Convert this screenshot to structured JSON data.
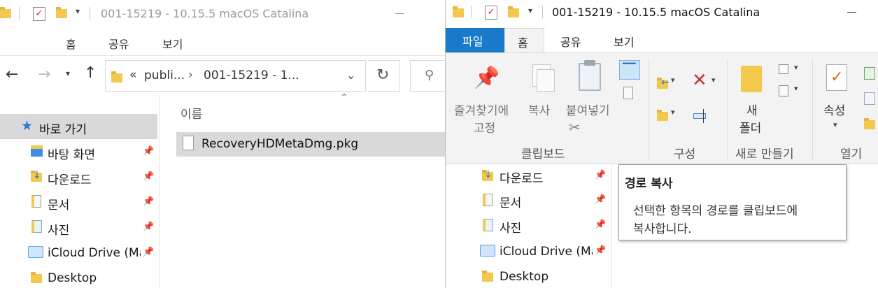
{
  "left": {
    "title": "001-15219 - 10.15.5 macOS Catalina",
    "ribbon_tabs": [
      "홈",
      "공유",
      "보기"
    ],
    "address": {
      "chevrons": "«",
      "part1": "publi...",
      "part2": "001-15219 - 1..."
    },
    "column_header": "이름",
    "file": "RecoveryHDMetaDmg.pkg",
    "nav": {
      "quick_access": "바로 가기",
      "items": [
        "바탕 화면",
        "다운로드",
        "문서",
        "사진",
        "iCloud Drive (Ma",
        "Desktop"
      ]
    }
  },
  "right": {
    "title": "001-15219 - 10.15.5 macOS Catalina",
    "tabs": {
      "file": "파일",
      "home": "홈",
      "share": "공유",
      "view": "보기"
    },
    "ribbon": {
      "pin_label_1": "즐겨찾기에",
      "pin_label_2": "고정",
      "copy": "복사",
      "paste": "붙여넣기",
      "clipboard_group": "클립보드",
      "organize_group": "구성",
      "new_folder_1": "새",
      "new_folder_2": "폴더",
      "new_group": "새로 만들기",
      "properties": "속성",
      "open_group": "열기"
    },
    "nav": {
      "items": [
        "다운로드",
        "문서",
        "사진",
        "iCloud Drive (Ma",
        "Desktop"
      ]
    },
    "tooltip": {
      "title": "경로 복사",
      "line1": "선택한 항목의 경로를 클립보드에",
      "line2": "복사합니다."
    }
  },
  "colors": {
    "accent": "#1979ca",
    "selected": "#d9d9d9",
    "ribbon_bg": "#f3f3f3"
  }
}
